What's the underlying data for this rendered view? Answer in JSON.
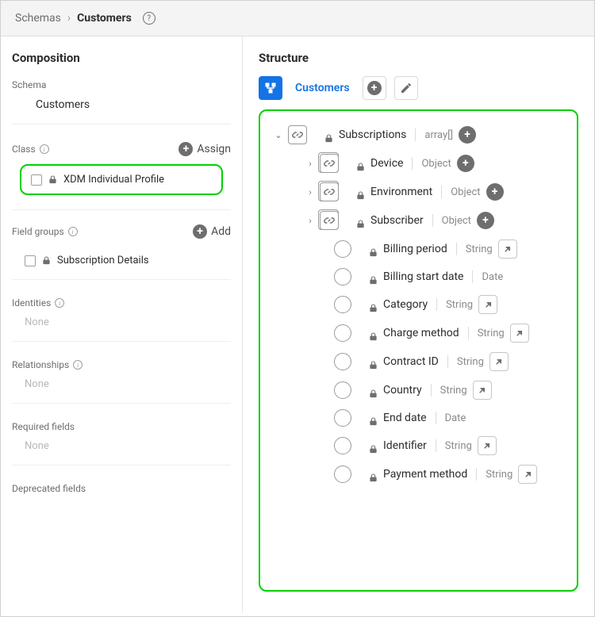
{
  "breadcrumb": {
    "parent": "Schemas",
    "sep": "›",
    "current": "Customers"
  },
  "left": {
    "title": "Composition",
    "schema_label": "Schema",
    "schema_name": "Customers",
    "class_label": "Class",
    "assign_label": "Assign",
    "class_item": "XDM Individual Profile",
    "fieldgroups_label": "Field groups",
    "add_label": "Add",
    "fieldgroup_item": "Subscription Details",
    "identities_label": "Identities",
    "identities_none": "None",
    "relationships_label": "Relationships",
    "relationships_none": "None",
    "required_label": "Required fields",
    "required_none": "None",
    "deprecated_label": "Deprecated fields"
  },
  "right": {
    "title": "Structure",
    "schema_link": "Customers",
    "tree": {
      "root": {
        "name": "Subscriptions",
        "type": "array[]"
      },
      "objects": [
        {
          "name": "Device",
          "type": "Object"
        },
        {
          "name": "Environment",
          "type": "Object"
        },
        {
          "name": "Subscriber",
          "type": "Object"
        }
      ],
      "fields": [
        {
          "name": "Billing period",
          "type": "String",
          "enum": true
        },
        {
          "name": "Billing start date",
          "type": "Date",
          "enum": false
        },
        {
          "name": "Category",
          "type": "String",
          "enum": true
        },
        {
          "name": "Charge method",
          "type": "String",
          "enum": true
        },
        {
          "name": "Contract ID",
          "type": "String",
          "enum": true
        },
        {
          "name": "Country",
          "type": "String",
          "enum": true
        },
        {
          "name": "End date",
          "type": "Date",
          "enum": false
        },
        {
          "name": "Identifier",
          "type": "String",
          "enum": true
        },
        {
          "name": "Payment method",
          "type": "String",
          "enum": true
        }
      ]
    }
  }
}
